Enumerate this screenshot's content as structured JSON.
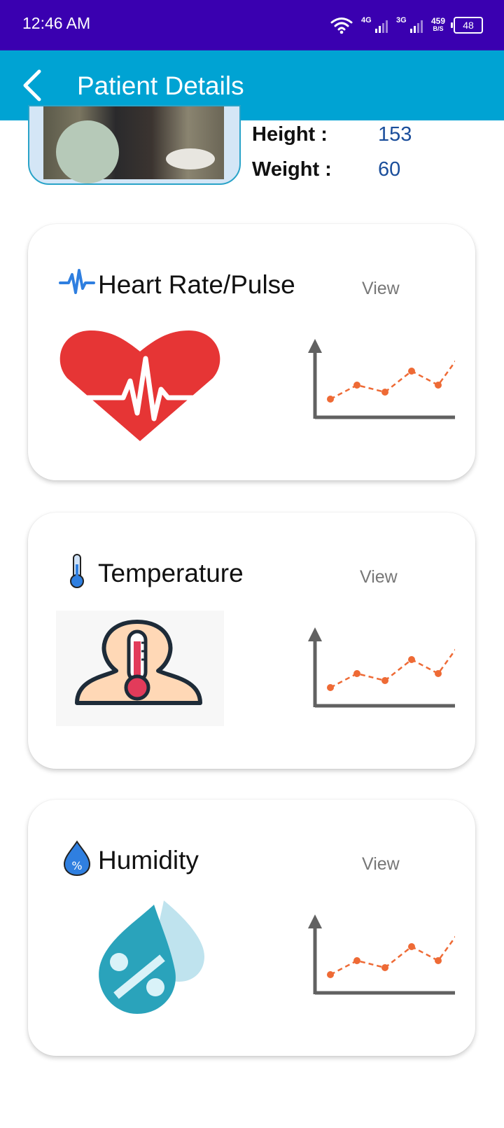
{
  "status_bar": {
    "time": "12:46 AM",
    "net1": "4G",
    "net2": "3G",
    "speed_value": "459",
    "speed_unit": "B/S",
    "battery": "48"
  },
  "header": {
    "title": "Patient Details"
  },
  "patient": {
    "height_label": "Height :",
    "height_value": "153",
    "weight_label": "Weight :",
    "weight_value": "60"
  },
  "cards": [
    {
      "title": "Heart Rate/Pulse",
      "view_label": "View",
      "icon": "pulse-icon",
      "illustration": "heart-ecg"
    },
    {
      "title": "Temperature",
      "view_label": "View",
      "icon": "thermometer-icon",
      "illustration": "person-thermometer"
    },
    {
      "title": "Humidity",
      "view_label": "View",
      "icon": "humidity-drop-icon",
      "illustration": "humidity-drops"
    }
  ],
  "colors": {
    "status_bar": "#3a00b0",
    "app_bar": "#00a3d3",
    "value_text": "#1b4e9b",
    "chart_line": "#ee6a35",
    "chart_axis": "#616161"
  }
}
